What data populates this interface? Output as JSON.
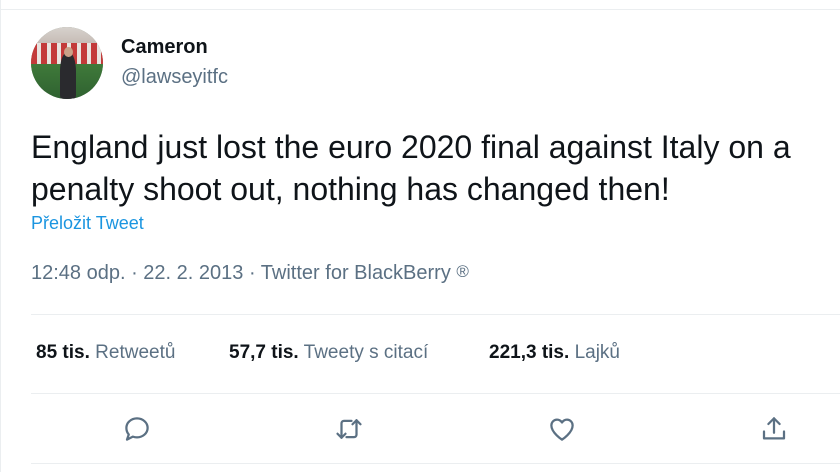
{
  "tweet": {
    "author_name": "Cameron",
    "author_handle": "@lawseyitfc",
    "text": "England just lost the euro 2020 final against Italy on a\npenalty shoot out, nothing has changed then!",
    "translate_label": "Přeložit Tweet",
    "timestamp": "12:48 odp. · 22. 2. 2013 · Twitter for BlackBerry",
    "registered_mark": "®"
  },
  "stats": [
    {
      "count": "85 tis.",
      "label": "Retweetů"
    },
    {
      "count": "57,7 tis.",
      "label": "Tweety s citací"
    },
    {
      "count": "221,3 tis.",
      "label": "Lajků"
    }
  ],
  "actions": [
    {
      "icon": "reply-icon"
    },
    {
      "icon": "retweet-icon"
    },
    {
      "icon": "like-icon"
    },
    {
      "icon": "share-icon"
    }
  ],
  "colors": {
    "link": "#1b95e0",
    "secondary_text": "#5b7083",
    "primary_text": "#0f1419",
    "divider": "#ebeef0"
  }
}
